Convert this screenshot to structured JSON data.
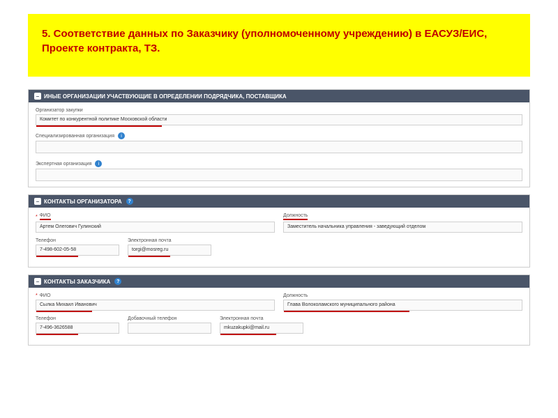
{
  "banner": {
    "title": "5. Соответствие данных по Заказчику (уполномоченному учреждению) в ЕАСУЗ/ЕИС, Проекте контракта, ТЗ."
  },
  "panel1": {
    "header": "ИНЫЕ ОРГАНИЗАЦИИ УЧАСТВУЮЩИЕ В ОПРЕДЕЛЕНИИ ПОДРЯДЧИКА, ПОСТАВЩИКА",
    "organizer_label": "Организатор закупки",
    "organizer_value": "Комитет по конкурентной политике Московской области",
    "specialized_label": "Специализированная организация",
    "expert_label": "Экспертная организация"
  },
  "panel2": {
    "header": "КОНТАКТЫ ОРГАНИЗАТОРА",
    "fio_label": "ФИО",
    "fio_value": "Артем Олегович Гулинский",
    "position_label": "Должность",
    "position_value": "Заместитель начальника управления - заведующий отделом",
    "phone_label": "Телефон",
    "phone_value": "7-498-602-05-58",
    "email_label": "Электронная почта",
    "email_value": "torgi@mosreg.ru"
  },
  "panel3": {
    "header": "КОНТАКТЫ ЗАКАЗЧИКА",
    "fio_label": "ФИО",
    "fio_value": "Сылка Михаил Иванович",
    "position_label": "Должность",
    "position_value": "Глава Волоколамского муниципального района",
    "phone_label": "Телефон",
    "phone_value": "7-496-3626588",
    "extra_phone_label": "Добавочный телефон",
    "email_label": "Электронная почта",
    "email_value": "mkuzakupki@mail.ru"
  }
}
